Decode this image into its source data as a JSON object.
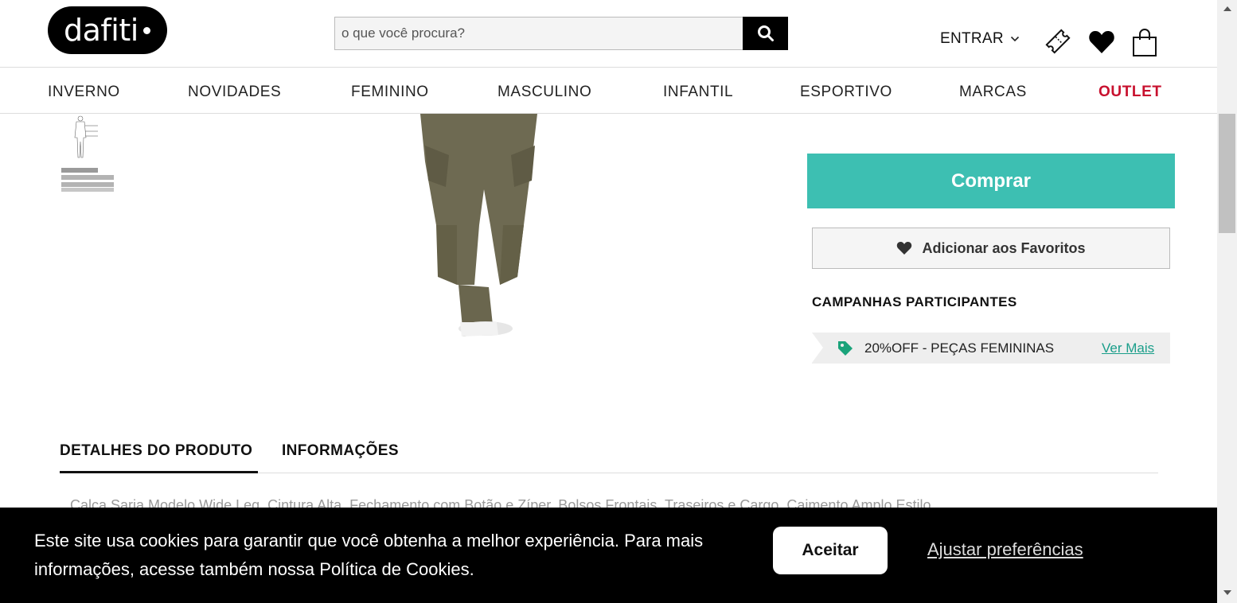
{
  "header": {
    "logo_text": "dafiti",
    "search_placeholder": "o que você procura?",
    "search_icon": "search-icon",
    "login_label": "ENTRAR",
    "icons": [
      "ticket-icon",
      "heart-icon",
      "shopping-bag-icon"
    ]
  },
  "nav": {
    "items": [
      "INVERNO",
      "NOVIDADES",
      "FEMININO",
      "MASCULINO",
      "INFANTIL",
      "ESPORTIVO",
      "MARCAS",
      "OUTLET"
    ]
  },
  "product": {
    "buy_label": "Comprar",
    "favorite_label": "Adicionar aos Favoritos",
    "campaigns_title": "CAMPANHAS PARTICIPANTES",
    "campaign_text": "20%OFF - PEÇAS FEMININAS",
    "campaign_link": "Ver Mais"
  },
  "tabs": {
    "details": "DETALHES DO PRODUTO",
    "info": "INFORMAÇÕES"
  },
  "description": "Calça Sarja Modelo Wide Leg, Cintura Alta, Fechamento com Botão e Zíper, Bolsos Frontais, Traseiros e Cargo, Caimento Amplo Estilo",
  "cookie": {
    "text": "Este site usa cookies para garantir que você obtenha a melhor experiência. Para mais informações, acesse também nossa Política de Cookies.",
    "accept_label": "Aceitar",
    "prefs_label": "Ajustar preferências"
  },
  "colors": {
    "buy_button": "#3dbfb2",
    "outlet": "#c8102e",
    "campaign_link": "#1a9e8a"
  }
}
